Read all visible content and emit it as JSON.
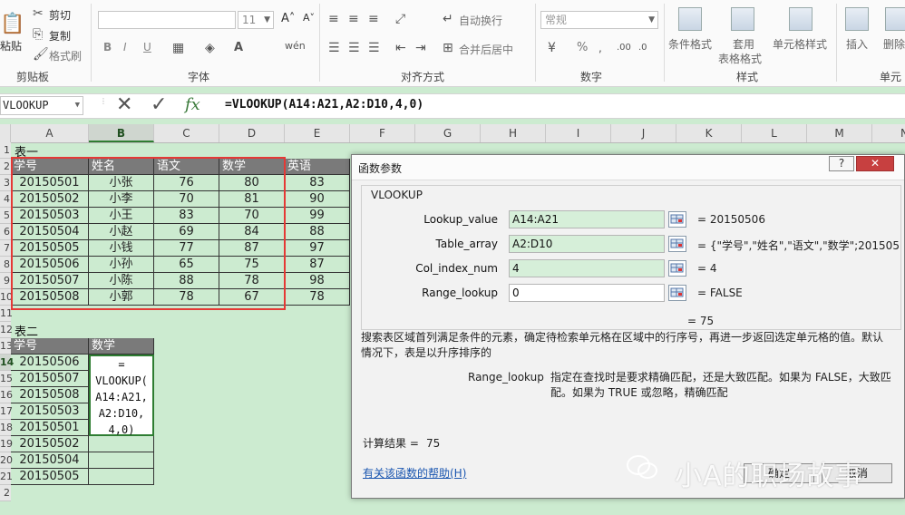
{
  "ribbon": {
    "clipboard": {
      "paste": "粘贴",
      "cut": "剪切",
      "copy": "复制",
      "format_painter": "格式刷",
      "group": "剪贴板"
    },
    "font": {
      "font_size": "11",
      "group": "字体",
      "bold": "B",
      "italic": "I",
      "underline": "U"
    },
    "alignment": {
      "wrap_text": "自动换行",
      "merge_center": "合并后居中",
      "group": "对齐方式"
    },
    "number": {
      "format": "常规",
      "group": "数字",
      "percent": "%"
    },
    "styles": {
      "conditional": "条件格式",
      "table_format_1": "套用",
      "table_format_2": "表格格式",
      "cell_styles": "单元格样式",
      "group": "样式"
    },
    "cells": {
      "insert": "插入",
      "delete": "删除",
      "group": "单元"
    }
  },
  "formula_bar": {
    "name_box": "VLOOKUP",
    "formula": "=VLOOKUP(A14:A21,A2:D10,4,0)",
    "fx": "fx"
  },
  "columns": [
    "A",
    "B",
    "C",
    "D",
    "E",
    "F",
    "G",
    "H",
    "I",
    "J",
    "K",
    "L",
    "M",
    "N"
  ],
  "rows": [
    "1",
    "2",
    "3",
    "4",
    "5",
    "6",
    "7",
    "8",
    "9",
    "10",
    "11",
    "12",
    "13",
    "14",
    "15",
    "16",
    "17",
    "18",
    "19",
    "20",
    "21",
    "2"
  ],
  "table1": {
    "title": "表一",
    "headers": [
      "学号",
      "姓名",
      "语文",
      "数学",
      "英语"
    ],
    "rows": [
      [
        "20150501",
        "小张",
        "76",
        "80",
        "83"
      ],
      [
        "20150502",
        "小李",
        "70",
        "81",
        "90"
      ],
      [
        "20150503",
        "小王",
        "83",
        "70",
        "99"
      ],
      [
        "20150504",
        "小赵",
        "69",
        "84",
        "88"
      ],
      [
        "20150505",
        "小钱",
        "77",
        "87",
        "97"
      ],
      [
        "20150506",
        "小孙",
        "65",
        "75",
        "87"
      ],
      [
        "20150507",
        "小陈",
        "88",
        "78",
        "98"
      ],
      [
        "20150508",
        "小郭",
        "78",
        "67",
        "78"
      ]
    ]
  },
  "table2": {
    "title": "表二",
    "headers": [
      "学号",
      "数学"
    ],
    "ids": [
      "20150506",
      "20150507",
      "20150508",
      "20150503",
      "20150501",
      "20150502",
      "20150504",
      "20150505"
    ],
    "editing_text": [
      "=",
      "VLOOKUP(",
      "A14:A21,",
      "A2:D10,",
      "4,0)"
    ]
  },
  "dialog": {
    "title": "函数参数",
    "help_glyph": "?",
    "close_glyph": "✕",
    "function_name": "VLOOKUP",
    "args": [
      {
        "label": "Lookup_value",
        "value": "A14:A21",
        "result": "=  20150506"
      },
      {
        "label": "Table_array",
        "value": "A2:D10",
        "result": "=  {\"学号\",\"姓名\",\"语文\",\"数学\";2015050"
      },
      {
        "label": "Col_index_num",
        "value": "4",
        "result": "=  4"
      },
      {
        "label": "Range_lookup",
        "value": "0",
        "result": "=  FALSE"
      }
    ],
    "overall_result": "=  75",
    "description_1": "搜索表区域首列满足条件的元素，确定待检索单元格在区域中的行序号，再进一步返回选定单元格的值。默认",
    "description_2": "情况下，表是以升序排序的",
    "arg_name": "Range_lookup",
    "arg_desc_1": "指定在查找时是要求精确匹配，还是大致匹配。如果为 FALSE，大致匹",
    "arg_desc_2": "配。如果为 TRUE 或忽略，精确匹配",
    "calc_label": "计算结果 =",
    "calc_value": "75",
    "help_link": "有关该函数的帮助(H)",
    "ok": "确定",
    "cancel": "取消"
  },
  "watermark": "小A的职场故事"
}
